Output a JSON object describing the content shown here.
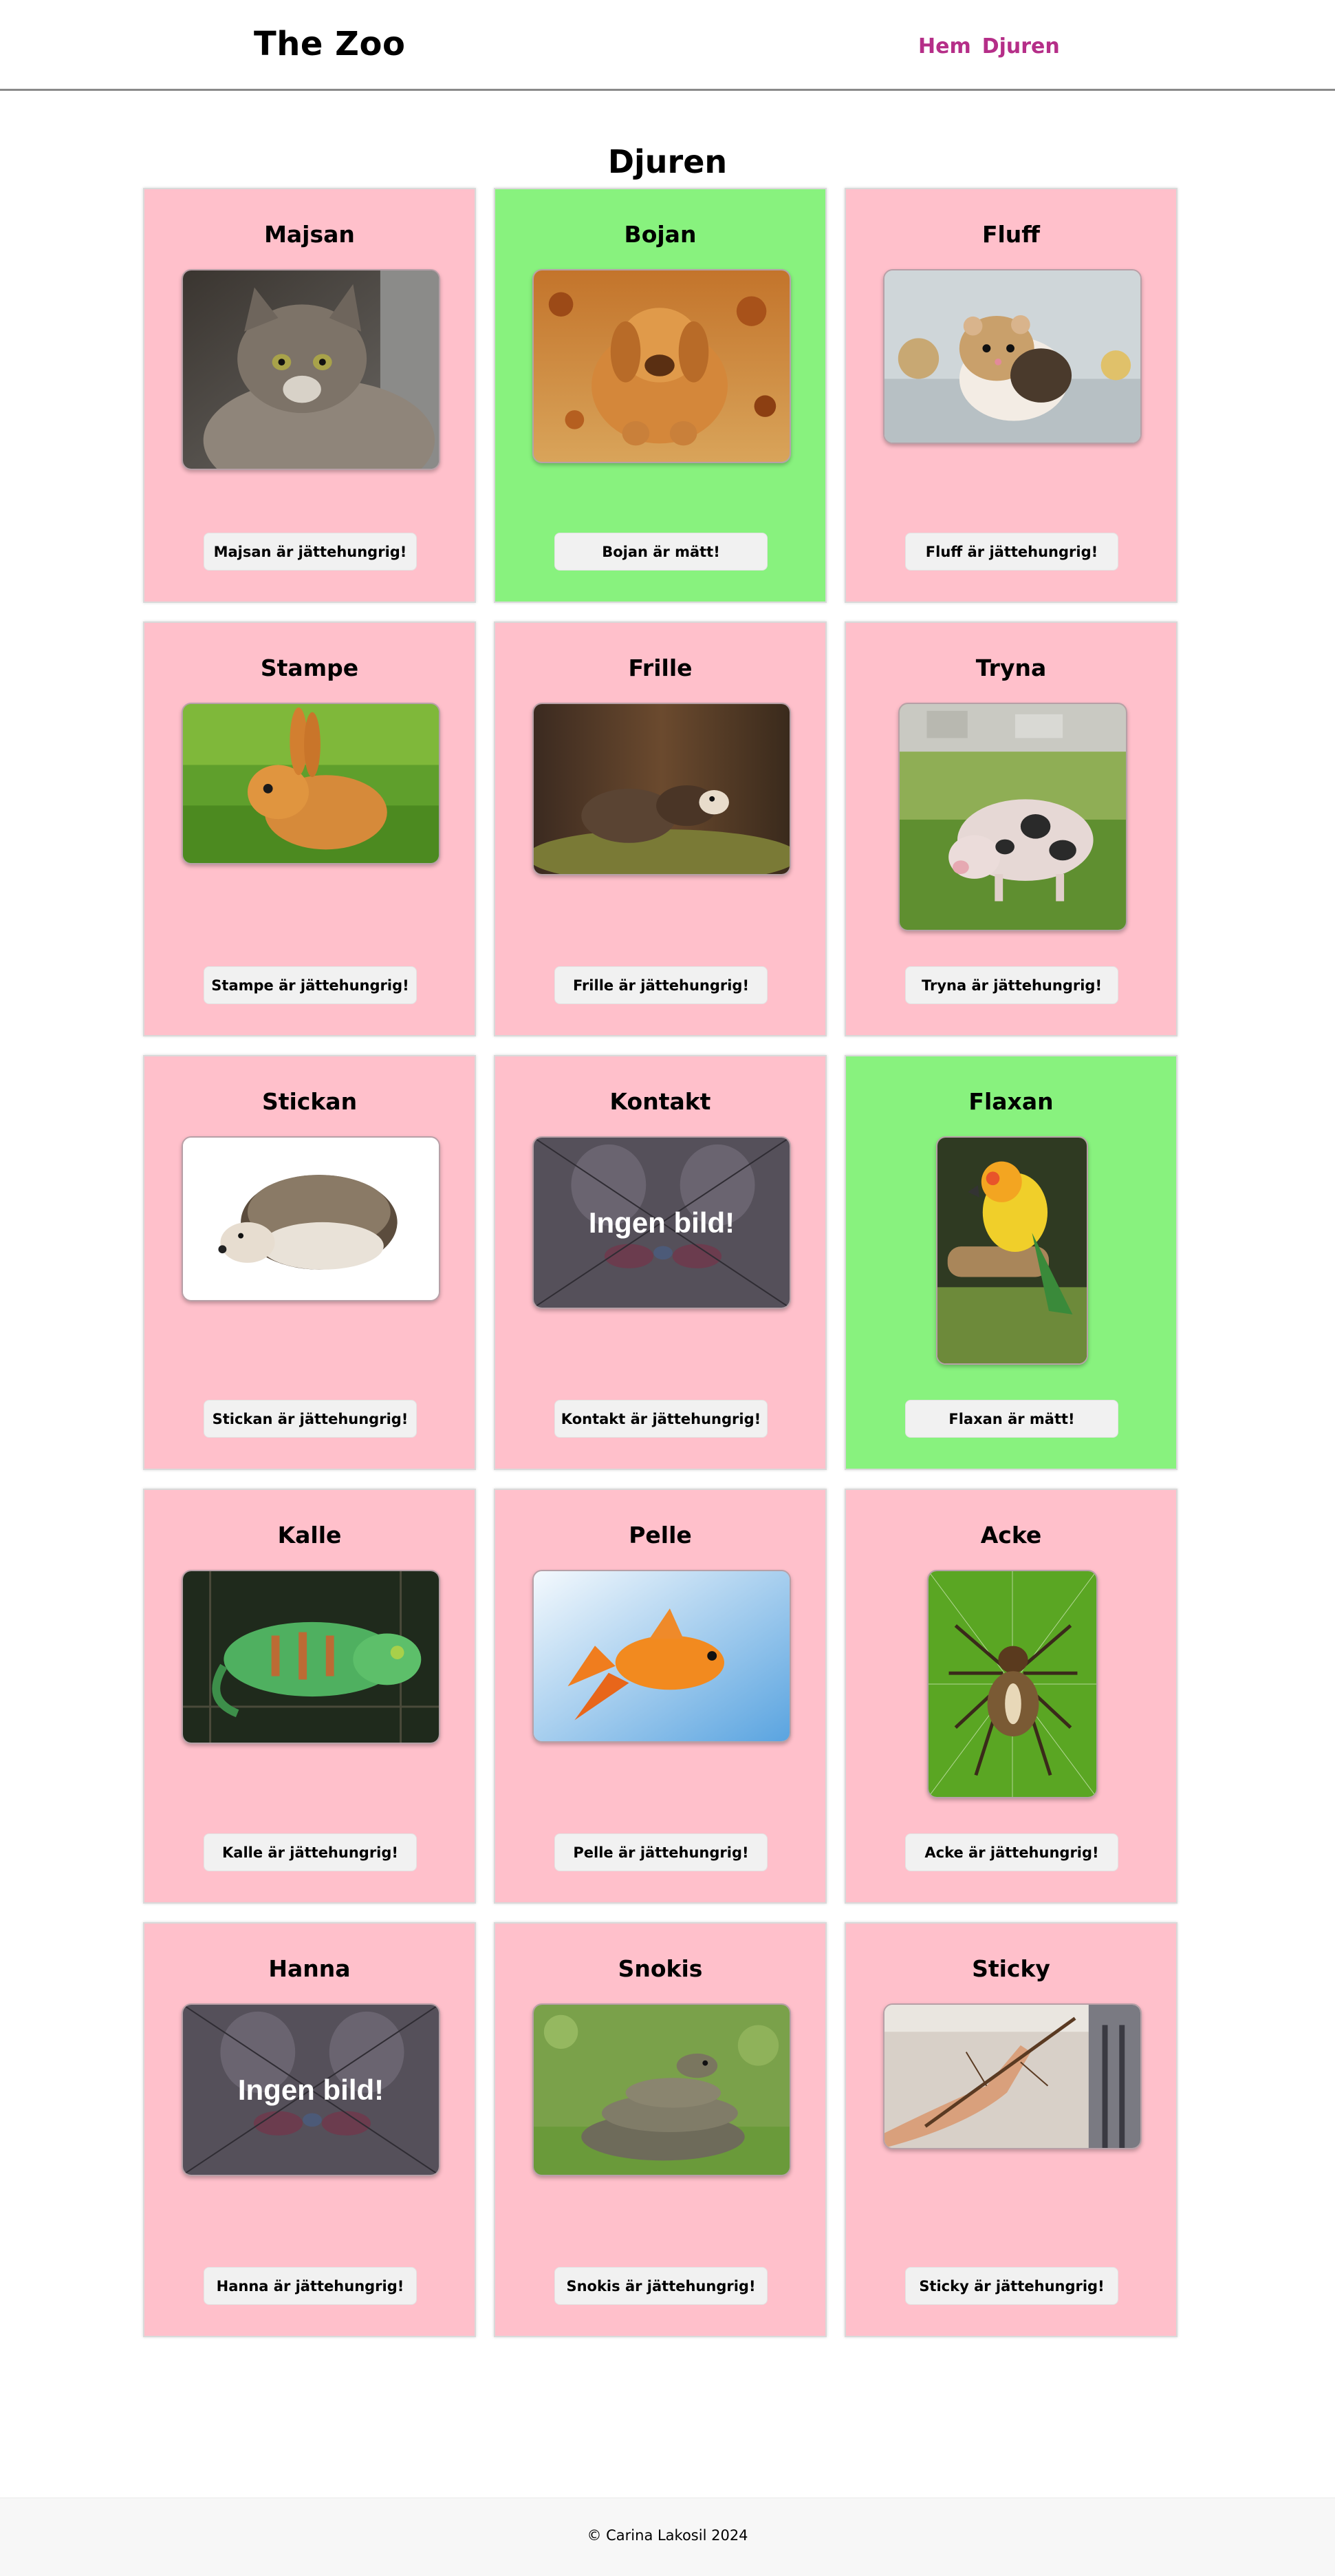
{
  "header": {
    "logo": "The Zoo",
    "nav": [
      {
        "label": "Hem"
      },
      {
        "label": "Djuren"
      }
    ],
    "nav_color": "#b52e88"
  },
  "page": {
    "title": "Djuren"
  },
  "colors": {
    "hungry": "#ffc0cb",
    "full": "#88f27e"
  },
  "animals": [
    {
      "name": "Majsan",
      "status": "Majsan är jättehungrig!",
      "fed": false,
      "image": "cat-photo"
    },
    {
      "name": "Bojan",
      "status": "Bojan är mätt!",
      "fed": true,
      "image": "dog-photo"
    },
    {
      "name": "Fluff",
      "status": "Fluff är jättehungrig!",
      "fed": false,
      "image": "hamster-photo"
    },
    {
      "name": "Stampe",
      "status": "Stampe är jättehungrig!",
      "fed": false,
      "image": "rabbit-photo"
    },
    {
      "name": "Frille",
      "status": "Frille är jättehungrig!",
      "fed": false,
      "image": "ferret-photo"
    },
    {
      "name": "Tryna",
      "status": "Tryna är jättehungrig!",
      "fed": false,
      "image": "pig-photo"
    },
    {
      "name": "Stickan",
      "status": "Stickan är jättehungrig!",
      "fed": false,
      "image": "hedgehog-photo"
    },
    {
      "name": "Kontakt",
      "status": "Kontakt är jättehungrig!",
      "fed": false,
      "image": "no-image-placeholder",
      "image_text": "Ingen bild!"
    },
    {
      "name": "Flaxan",
      "status": "Flaxan är mätt!",
      "fed": true,
      "image": "parrot-photo"
    },
    {
      "name": "Kalle",
      "status": "Kalle är jättehungrig!",
      "fed": false,
      "image": "chameleon-photo"
    },
    {
      "name": "Pelle",
      "status": "Pelle är jättehungrig!",
      "fed": false,
      "image": "goldfish-photo"
    },
    {
      "name": "Acke",
      "status": "Acke är jättehungrig!",
      "fed": false,
      "image": "spider-photo"
    },
    {
      "name": "Hanna",
      "status": "Hanna är jättehungrig!",
      "fed": false,
      "image": "no-image-placeholder",
      "image_text": "Ingen bild!"
    },
    {
      "name": "Snokis",
      "status": "Snokis är jättehungrig!",
      "fed": false,
      "image": "snake-photo"
    },
    {
      "name": "Sticky",
      "status": "Sticky är jättehungrig!",
      "fed": false,
      "image": "stick-insect-photo"
    }
  ],
  "footer": {
    "text": "© Carina Lakosil 2024"
  }
}
